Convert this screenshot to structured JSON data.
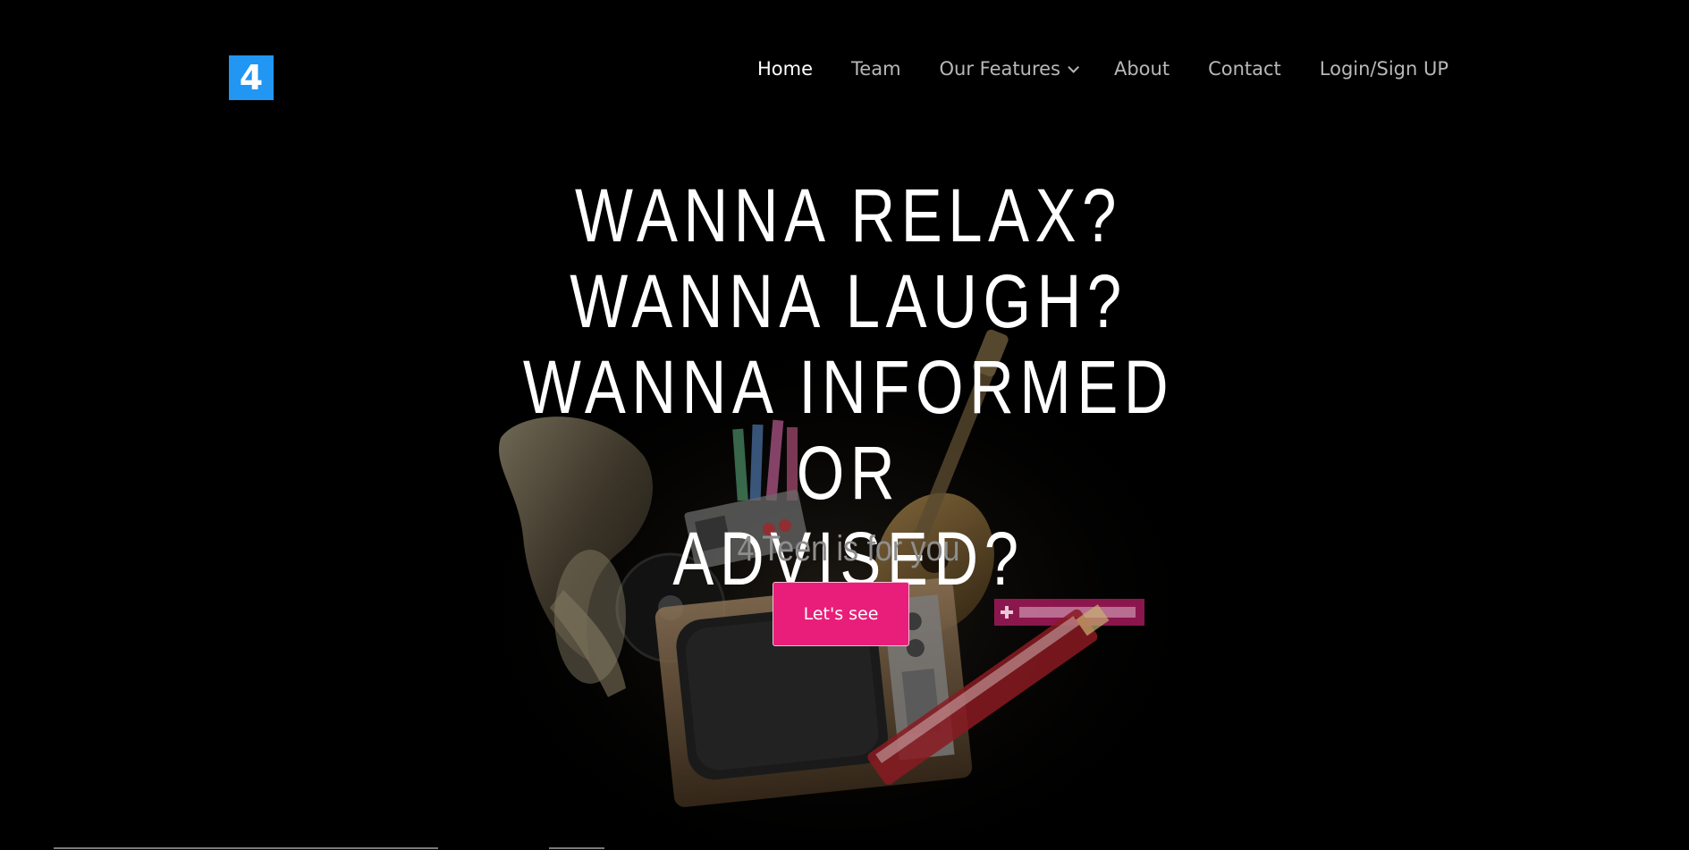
{
  "brand": {
    "logo_text": "4",
    "logo_color": "#2196f3"
  },
  "nav": {
    "items": [
      {
        "label": "Home",
        "active": true
      },
      {
        "label": "Team",
        "active": false
      },
      {
        "label": "Our Features",
        "active": false,
        "has_dropdown": true
      },
      {
        "label": "About",
        "active": false
      },
      {
        "label": "Contact",
        "active": false
      },
      {
        "label": "Login/Sign UP",
        "active": false
      }
    ]
  },
  "hero": {
    "headline_lines": [
      "WANNA RELAX?",
      "WANNA LAUGH?",
      "WANNA INFORMED OR",
      "ADVISED?"
    ],
    "tagline": "4 Teen is for you",
    "cta_label": "Let's see",
    "cta_color": "#e91e7a",
    "background_art": "retro-media-collage-icon"
  }
}
